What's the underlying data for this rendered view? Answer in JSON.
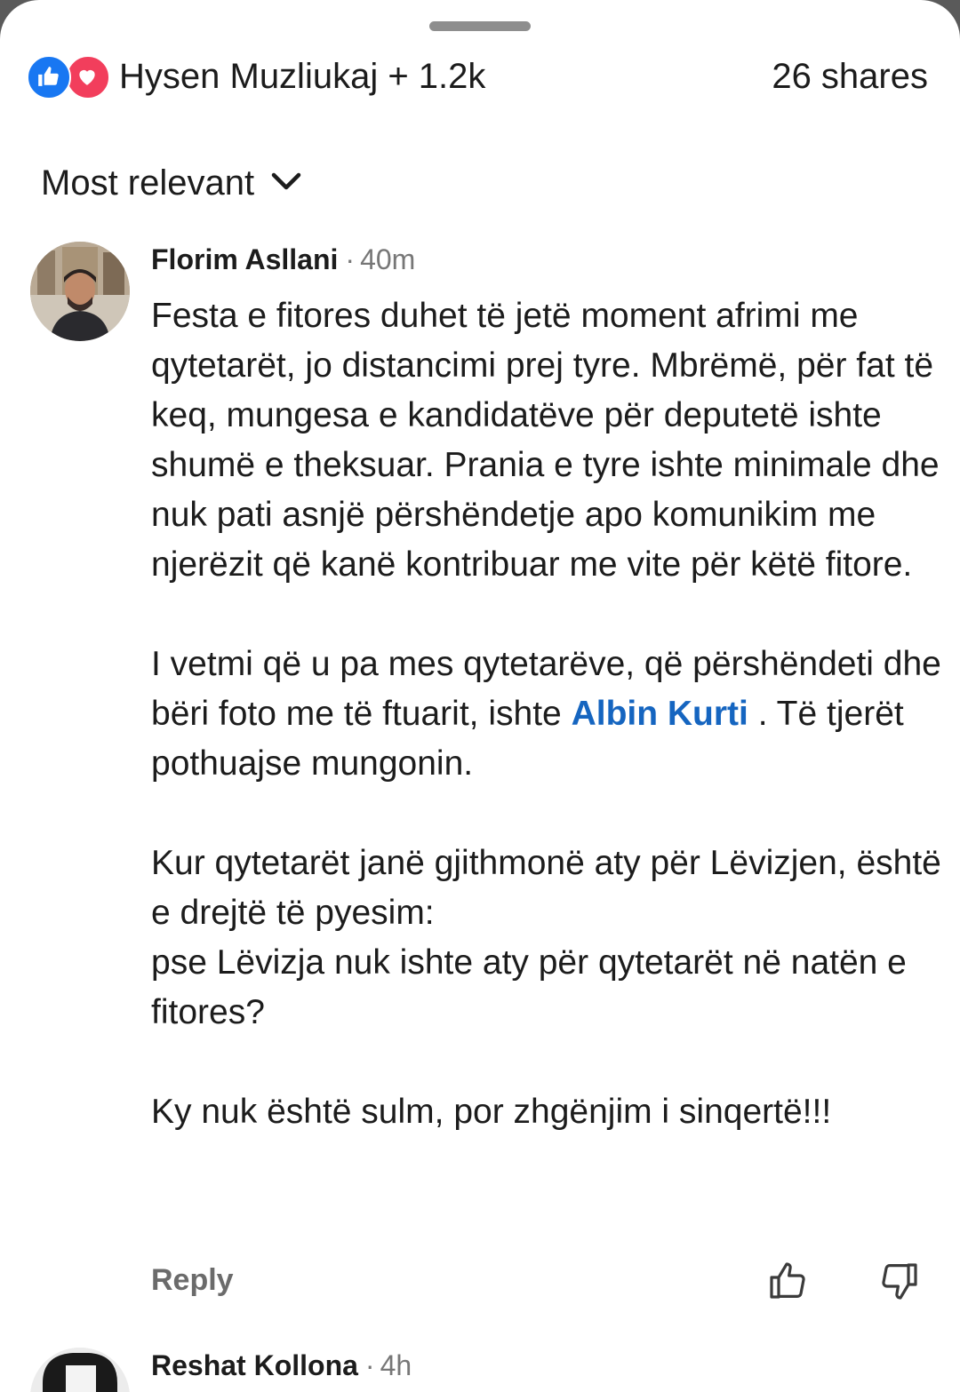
{
  "reactions": {
    "summary": "Hysen Muzliukaj + 1.2k",
    "shares": "26 shares",
    "icons": [
      "like-icon",
      "love-icon"
    ],
    "colors": {
      "like": "#1877f2",
      "love": "#f23e5c"
    }
  },
  "sort": {
    "label": "Most relevant"
  },
  "comments": [
    {
      "author": "Florim Asllani",
      "separator": "·",
      "time": "40m",
      "paragraphs": [
        "Festa e fitores duhet të jetë moment afrimi me qytetarët, jo distancimi prej tyre. Mbrëmë, për fat të keq, mungesa e kandidatëve për deputetë ishte shumë e theksuar. Prania e tyre ishte minimale dhe nuk pati asnjë përshëndetje apo komunikim me njerëzit që kanë kontribuar me vite për këtë fitore."
      ],
      "p2_before": "I vetmi që u pa mes qytetarëve, që përshëndeti dhe bëri foto me të ftuarit, ishte ",
      "mention": "Albin Kurti",
      "p2_after": " . Të tjerët pothuajse mungonin.",
      "p3_line1": "Kur qytetarët janë gjithmonë aty për Lëvizjen, është e drejtë të pyesim:",
      "p3_line2": "pse Lëvizja nuk ishte aty për qytetarët në natën e fitores?",
      "p4": "Ky nuk është sulm, por zhgënjim i sinqertë!!!",
      "reply_label": "Reply",
      "mention_color": "#1565c0"
    },
    {
      "author": "Reshat Kollona",
      "separator": "·",
      "time": "4h"
    }
  ]
}
